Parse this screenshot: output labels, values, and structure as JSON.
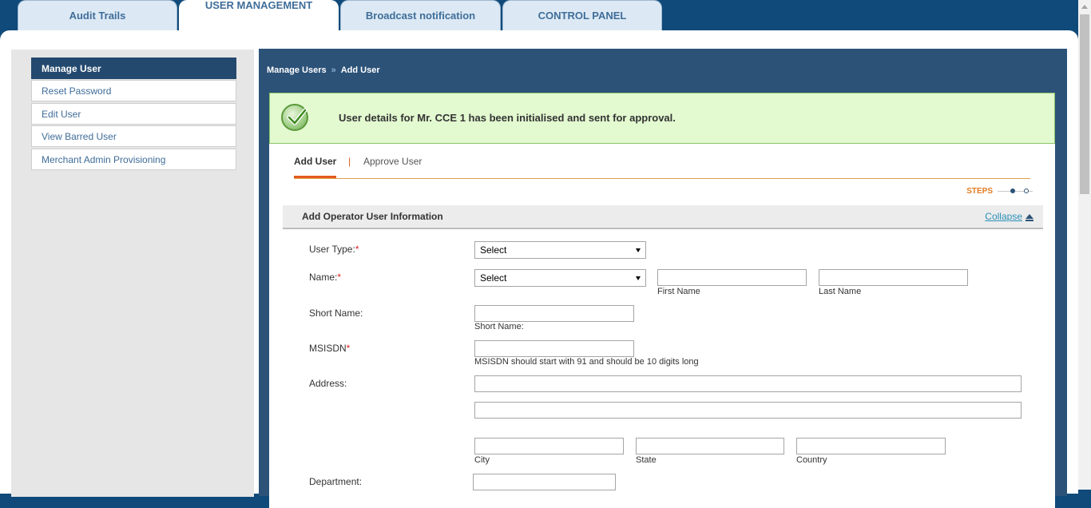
{
  "tabs": {
    "audit": "Audit Trails",
    "user_mgmt": "USER MANAGEMENT",
    "broadcast": "Broadcast notification",
    "control": "CONTROL PANEL"
  },
  "sidebar": {
    "items": [
      {
        "label": "Manage User"
      },
      {
        "label": "Reset Password"
      },
      {
        "label": "Edit User"
      },
      {
        "label": "View Barred User"
      },
      {
        "label": "Merchant Admin Provisioning"
      }
    ]
  },
  "breadcrumb": {
    "first": "Manage Users",
    "separator": "»",
    "second": "Add User"
  },
  "alert": {
    "message": "User details for Mr. CCE 1 has been initialised and sent for approval."
  },
  "subtabs": {
    "add": "Add User",
    "divider": "|",
    "approve": "Approve User"
  },
  "steps": {
    "label": "STEPS"
  },
  "section": {
    "title": "Add Operator User Information",
    "collapse": "Collapse"
  },
  "form": {
    "user_type_label": "User Type:",
    "user_type_value": "Select",
    "name_label": "Name:",
    "name_title_value": "Select",
    "first_name_hint": "First Name",
    "last_name_hint": "Last Name",
    "short_name_label": "Short Name:",
    "short_name_hint": "Short Name:",
    "msisdn_label": "MSISDN",
    "msisdn_hint": "MSISDN should start with 91 and should be 10 digits long",
    "address_label": "Address:",
    "city_hint": "City",
    "state_hint": "State",
    "country_hint": "Country",
    "department_label": "Department:",
    "required_mark": "*"
  },
  "colors": {
    "header_bg": "#0f4a7a",
    "panel_bg": "#2c5278",
    "alert_bg": "#e3f9d0",
    "accent": "#e35a1e"
  }
}
